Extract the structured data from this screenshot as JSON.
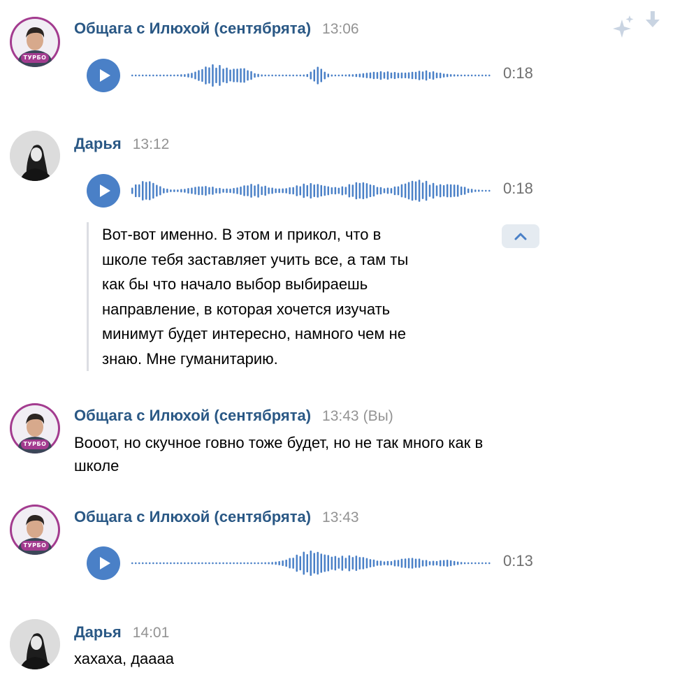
{
  "icons": {
    "sparkle": "sparkle-icon",
    "download": "download-arrow-icon",
    "play": "play-icon",
    "collapse": "chevron-up-icon"
  },
  "colors": {
    "author": "#2a5885",
    "accent": "#4a80c7",
    "turbo": "#a33b8f",
    "muted": "#939393"
  },
  "messages": [
    {
      "author": "Общага с Илюхой (сентябрята)",
      "time": "13:06",
      "badge": "ТУРБО",
      "audio": {
        "duration": "0:18"
      }
    },
    {
      "author": "Дарья",
      "time": "13:12",
      "audio": {
        "duration": "0:18"
      },
      "transcript": [
        "Вот-вот именно. В этом и прикол, что в",
        "школе тебя заставляет учить все, а там ты",
        "как бы что начало выбор выбираешь",
        "направление, в которая хочется изучать",
        "минимут будет интересно, намного чем не",
        "знаю. Мне гуманитарию."
      ]
    },
    {
      "author": "Общага с Илюхой (сентябрята)",
      "time": "13:43",
      "you": "(Вы)",
      "badge": "ТУРБО",
      "text": [
        "Вoooт, но скучное говно тоже будет, но не так много как в",
        "школе"
      ]
    },
    {
      "author": "Общага с Илюхой (сентябрята)",
      "time": "13:43",
      "badge": "ТУРБО",
      "audio": {
        "duration": "0:13"
      }
    },
    {
      "author": "Дарья",
      "time": "14:01",
      "text": [
        "хахаха, даааа"
      ]
    }
  ]
}
